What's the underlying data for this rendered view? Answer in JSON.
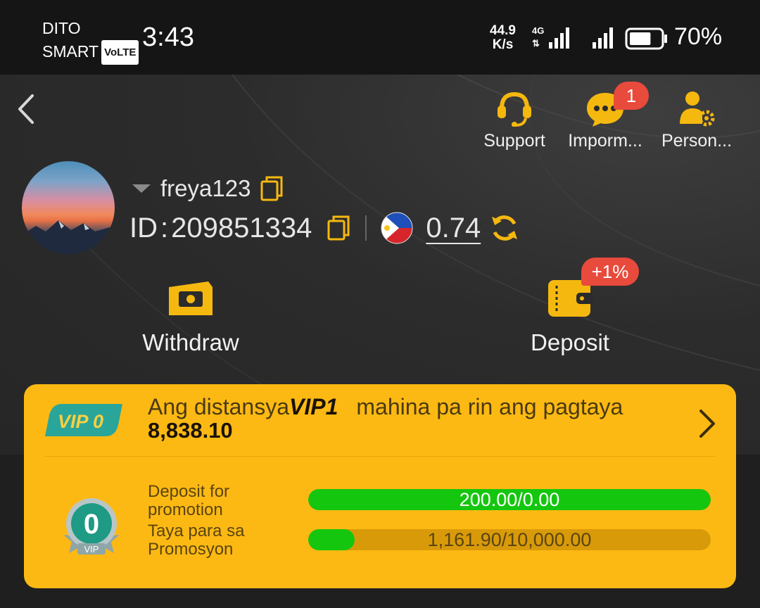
{
  "status_bar": {
    "carrier_line1": "DITO",
    "carrier_line2": "SMART",
    "volte": "VoLTE",
    "time": "3:43",
    "net_speed_value": "44.9",
    "net_speed_unit": "K/s",
    "network_type": "4G",
    "battery_percent": "70%",
    "battery_level": 0.7
  },
  "nav": {
    "support_label": "Support",
    "messages_label": "Imporm...",
    "messages_badge": "1",
    "personal_label": "Person..."
  },
  "profile": {
    "username": "freya123",
    "id_label": "ID",
    "id_separator": ":",
    "id_value": "209851334",
    "balance": "0.74",
    "country_flag": "philippines-flag-icon"
  },
  "actions": {
    "withdraw_label": "Withdraw",
    "deposit_label": "Deposit",
    "deposit_bonus": "+1%"
  },
  "vip": {
    "current_level_tag": "VIP 0",
    "distance_prefix": "Ang distansya",
    "next_level": "VIP1",
    "distance_suffix": "mahina pa rin ang pagtaya",
    "remaining_amount": "8,838.10",
    "medal_level": "0",
    "medal_label": "VIP",
    "requirements": [
      {
        "label": "Deposit for promotion",
        "progress_text": "200.00/0.00",
        "progress_fraction": 1.0
      },
      {
        "label": "Taya para sa Promosyon",
        "progress_text": "1,161.90/10,000.00",
        "progress_fraction": 0.116
      }
    ]
  },
  "colors": {
    "accent_yellow": "#fdb913",
    "icon_yellow": "#f5b80f",
    "badge_red": "#e84a3c",
    "progress_green": "#15c60f",
    "vip_teal": "#2aa59a"
  }
}
